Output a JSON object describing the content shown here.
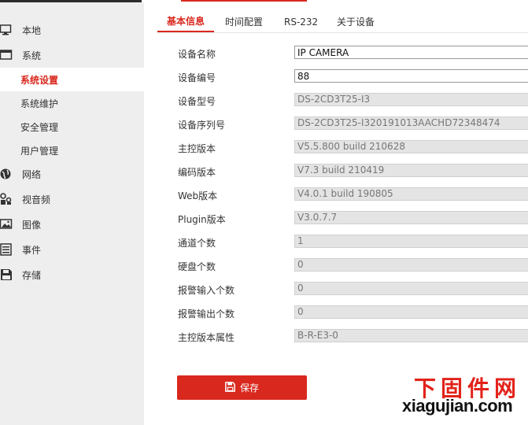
{
  "sidebar": {
    "items": [
      {
        "label": "本地",
        "icon": "monitor-icon"
      },
      {
        "label": "系统",
        "icon": "system-icon"
      },
      {
        "label": "系统设置",
        "active": true
      },
      {
        "label": "系统维护"
      },
      {
        "label": "安全管理"
      },
      {
        "label": "用户管理"
      },
      {
        "label": "网络",
        "icon": "globe-icon"
      },
      {
        "label": "视音频",
        "icon": "audio-video-icon"
      },
      {
        "label": "图像",
        "icon": "image-icon"
      },
      {
        "label": "事件",
        "icon": "list-icon"
      },
      {
        "label": "存储",
        "icon": "save-icon"
      }
    ]
  },
  "tabs": [
    {
      "label": "基本信息",
      "active": true
    },
    {
      "label": "时间配置"
    },
    {
      "label": "RS-232"
    },
    {
      "label": "关于设备"
    }
  ],
  "form": {
    "rows": [
      {
        "label": "设备名称",
        "value": "IP CAMERA",
        "editable": true
      },
      {
        "label": "设备编号",
        "value": "88",
        "editable": true
      },
      {
        "label": "设备型号",
        "value": "DS-2CD3T25-I3"
      },
      {
        "label": "设备序列号",
        "value": "DS-2CD3T25-I320191013AACHD72348474"
      },
      {
        "label": "主控版本",
        "value": "V5.5.800 build 210628"
      },
      {
        "label": "编码版本",
        "value": "V7.3 build 210419"
      },
      {
        "label": "Web版本",
        "value": "V4.0.1 build 190805"
      },
      {
        "label": "Plugin版本",
        "value": "V3.0.7.7"
      },
      {
        "label": "通道个数",
        "value": "1"
      },
      {
        "label": "硬盘个数",
        "value": "0"
      },
      {
        "label": "报警输入个数",
        "value": "0"
      },
      {
        "label": "报警输出个数",
        "value": "0"
      },
      {
        "label": "主控版本属性",
        "value": "B-R-E3-0"
      }
    ]
  },
  "save_button": {
    "label": "保存",
    "icon": "save-icon"
  },
  "watermark": {
    "chinese": "下固件网",
    "domain": "xiagujian.com"
  },
  "colors": {
    "accent": "#d9281e",
    "sidebar_bg": "#eeeeee",
    "readonly_bg": "#e4e4e4"
  }
}
